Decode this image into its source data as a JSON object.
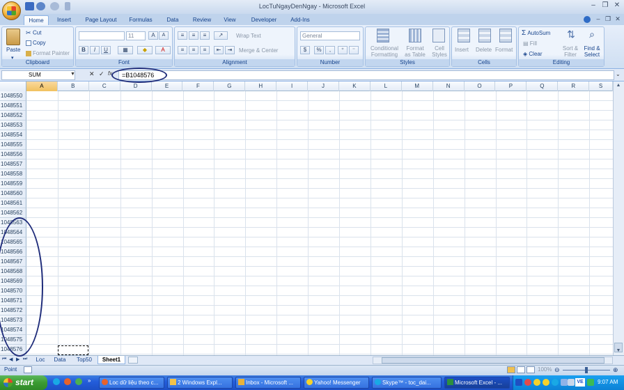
{
  "window": {
    "title": "LocTuNgayDenNgay - Microsoft Excel"
  },
  "tabs": [
    "Home",
    "Insert",
    "Page Layout",
    "Formulas",
    "Data",
    "Review",
    "View",
    "Developer",
    "Add-Ins"
  ],
  "ribbon": {
    "clipboard": {
      "label": "Clipboard",
      "paste": "Paste",
      "cut": "Cut",
      "copy": "Copy",
      "format_painter": "Format Painter"
    },
    "font": {
      "label": "Font",
      "size": "11",
      "bold": "B",
      "italic": "I",
      "underline": "U"
    },
    "alignment": {
      "label": "Alignment",
      "wrap_text": "Wrap Text",
      "merge_center": "Merge & Center"
    },
    "number": {
      "label": "Number",
      "format": "General",
      "currency": "$",
      "percent": "%",
      "comma": ","
    },
    "styles": {
      "label": "Styles",
      "conditional_1": "Conditional",
      "conditional_2": "Formatting",
      "format_table_1": "Format",
      "format_table_2": "as Table",
      "cell_styles_1": "Cell",
      "cell_styles_2": "Styles"
    },
    "cells": {
      "label": "Cells",
      "insert": "Insert",
      "delete": "Delete",
      "format": "Format"
    },
    "editing": {
      "label": "Editing",
      "autosum": "AutoSum",
      "fill": "Fill",
      "clear": "Clear",
      "sort_1": "Sort &",
      "sort_2": "Filter",
      "find_1": "Find &",
      "find_2": "Select"
    }
  },
  "formula_bar": {
    "name_box": "SUM",
    "cancel": "✕",
    "enter": "✓",
    "fx": "fx",
    "formula": "=B1048576"
  },
  "columns": [
    "A",
    "B",
    "C",
    "D",
    "E",
    "F",
    "G",
    "H",
    "I",
    "J",
    "K",
    "L",
    "M",
    "N",
    "O",
    "P",
    "Q",
    "R",
    "S"
  ],
  "rows": [
    "1048550",
    "1048551",
    "1048552",
    "1048553",
    "1048554",
    "1048555",
    "1048556",
    "1048557",
    "1048558",
    "1048559",
    "1048560",
    "1048561",
    "1048562",
    "1048563",
    "1048564",
    "1048565",
    "1048566",
    "1048567",
    "1048568",
    "1048569",
    "1048570",
    "1048571",
    "1048572",
    "1048573",
    "1048574",
    "1048575",
    "1048576"
  ],
  "sheets": [
    "Loc",
    "Data",
    "Top50",
    "Sheet1"
  ],
  "active_sheet": "Sheet1",
  "status": {
    "mode": "Point",
    "zoom": "100%"
  },
  "taskbar": {
    "start": "start",
    "items": [
      "Loc dữ liệu theo c...",
      "2 Windows Expl...",
      "Inbox - Microsoft ...",
      "Yahoo! Messenger",
      "Skype™ - toc_dai...",
      "Microsoft Excel - ..."
    ],
    "clock": "9:07 AM",
    "tray_lang": "VE"
  },
  "colors": {
    "accent": "#15428b",
    "annotation": "#1f2c7a",
    "selected_col": "#f1c15f"
  }
}
